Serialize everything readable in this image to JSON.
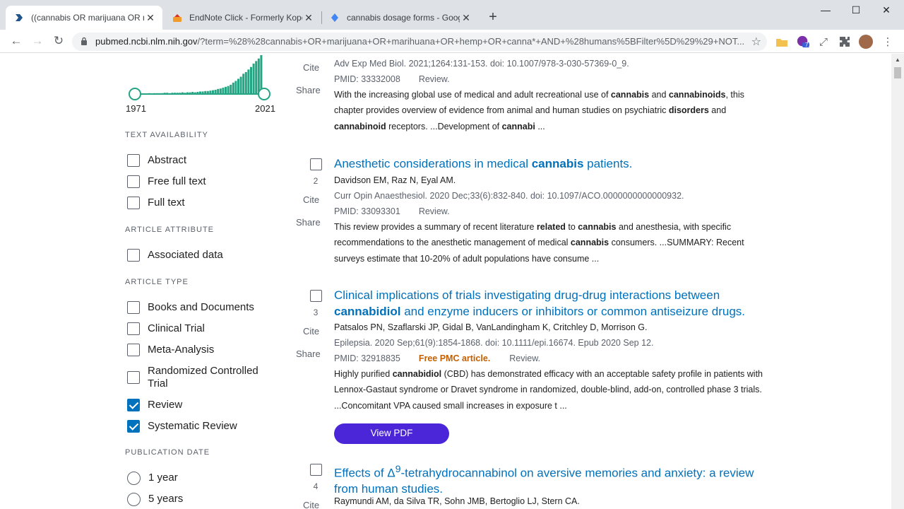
{
  "tabs": [
    {
      "title": "((cannabis OR marijuana OR mari",
      "active": true
    },
    {
      "title": "EndNote Click - Formerly Kopern",
      "active": false
    },
    {
      "title": "cannabis dosage forms - Google",
      "active": false
    }
  ],
  "window": {
    "minimize": "—",
    "maximize": "☐",
    "close": "✕"
  },
  "address": {
    "domain": "pubmed.ncbi.nlm.nih.gov",
    "path": "/?term=%28%28cannabis+OR+marijuana+OR+marihuana+OR+hemp+OR+canna*+AND+%28humans%5BFilter%5D%29%29+NOT..."
  },
  "extensions": {
    "badge": "71"
  },
  "timeline": {
    "start_year": "1971",
    "end_year": "2021",
    "bars": [
      1,
      1,
      1,
      1,
      1,
      2,
      1,
      2,
      2,
      2,
      2,
      3,
      3,
      2,
      3,
      3,
      3,
      3,
      4,
      3,
      4,
      4,
      5,
      4,
      5,
      6,
      6,
      7,
      7,
      8,
      9,
      10,
      12,
      13,
      15,
      17,
      19,
      22,
      27,
      31,
      36,
      41,
      48,
      52,
      58,
      64,
      72,
      78,
      84,
      92
    ],
    "colors": {
      "bar": "#25a584",
      "track": "#5b616b"
    }
  },
  "facets": {
    "text_availability": {
      "heading": "TEXT AVAILABILITY",
      "items": [
        {
          "label": "Abstract",
          "checked": false
        },
        {
          "label": "Free full text",
          "checked": false
        },
        {
          "label": "Full text",
          "checked": false
        }
      ]
    },
    "article_attribute": {
      "heading": "ARTICLE ATTRIBUTE",
      "items": [
        {
          "label": "Associated data",
          "checked": false
        }
      ]
    },
    "article_type": {
      "heading": "ARTICLE TYPE",
      "items": [
        {
          "label": "Books and Documents",
          "checked": false
        },
        {
          "label": "Clinical Trial",
          "checked": false
        },
        {
          "label": "Meta-Analysis",
          "checked": false
        },
        {
          "label": "Randomized Controlled Trial",
          "checked": false
        },
        {
          "label": "Review",
          "checked": true
        },
        {
          "label": "Systematic Review",
          "checked": true
        }
      ]
    },
    "publication_date": {
      "heading": "PUBLICATION DATE",
      "items": [
        {
          "label": "1 year",
          "checked": false
        },
        {
          "label": "5 years",
          "checked": false
        }
      ]
    }
  },
  "actions": {
    "cite": "Cite",
    "share": "Share",
    "view_pdf": "View PDF"
  },
  "articles": [
    {
      "citation": "Adv Exp Med Biol. 2021;1264:131-153. doi: 10.1007/978-3-030-57369-0_9.",
      "pmid": "PMID: 33332008",
      "type": "Review.",
      "abstract_html": "With the increasing global use of medical and adult recreational use of <b>cannabis</b> and <b>cannabinoids</b>, this chapter provides overview of evidence from animal and human studies on psychiatric <b>disorders</b> and <b>cannabinoid</b> receptors. ...Development of <b>cannabi</b> ..."
    },
    {
      "number": "2",
      "title_html": "Anesthetic considerations in medical <b>cannabis</b> patients.",
      "authors": "Davidson EM, Raz N, Eyal AM.",
      "citation": "Curr Opin Anaesthesiol. 2020 Dec;33(6):832-840. doi: 10.1097/ACO.0000000000000932.",
      "pmid": "PMID: 33093301",
      "type": "Review.",
      "abstract_html": "This review provides a summary of recent literature <b>related</b> to <b>cannabis</b> and anesthesia, with specific recommendations to the anesthetic management of medical <b>cannabis</b> consumers. ...SUMMARY: Recent surveys estimate that 10-20% of adult populations have consume ..."
    },
    {
      "number": "3",
      "title_html": "Clinical implications of trials investigating drug-drug interactions between <b>cannabidiol</b> and enzyme inducers or inhibitors or common antiseizure drugs.",
      "authors": "Patsalos PN, Szaflarski JP, Gidal B, VanLandingham K, Critchley D, Morrison G.",
      "citation": "Epilepsia. 2020 Sep;61(9):1854-1868. doi: 10.1111/epi.16674. Epub 2020 Sep 12.",
      "pmid": "PMID: 32918835",
      "free_pmc": "Free PMC article.",
      "type": "Review.",
      "abstract_html": "Highly purified <b>cannabidiol</b> (CBD) has demonstrated efficacy with an acceptable safety profile in patients with Lennox-Gastaut syndrome or Dravet syndrome in randomized, double-blind, add-on, controlled phase 3 trials. ...Concomitant VPA caused small increases in exposure t ..."
    },
    {
      "number": "4",
      "title_html": "Effects of Δ<sup>9</sup>-tetrahydrocannabinol on aversive memories and anxiety: a review from human studies.",
      "authors": "Raymundi AM, da Silva TR, Sohn JMB, Bertoglio LJ, Stern CA."
    }
  ]
}
